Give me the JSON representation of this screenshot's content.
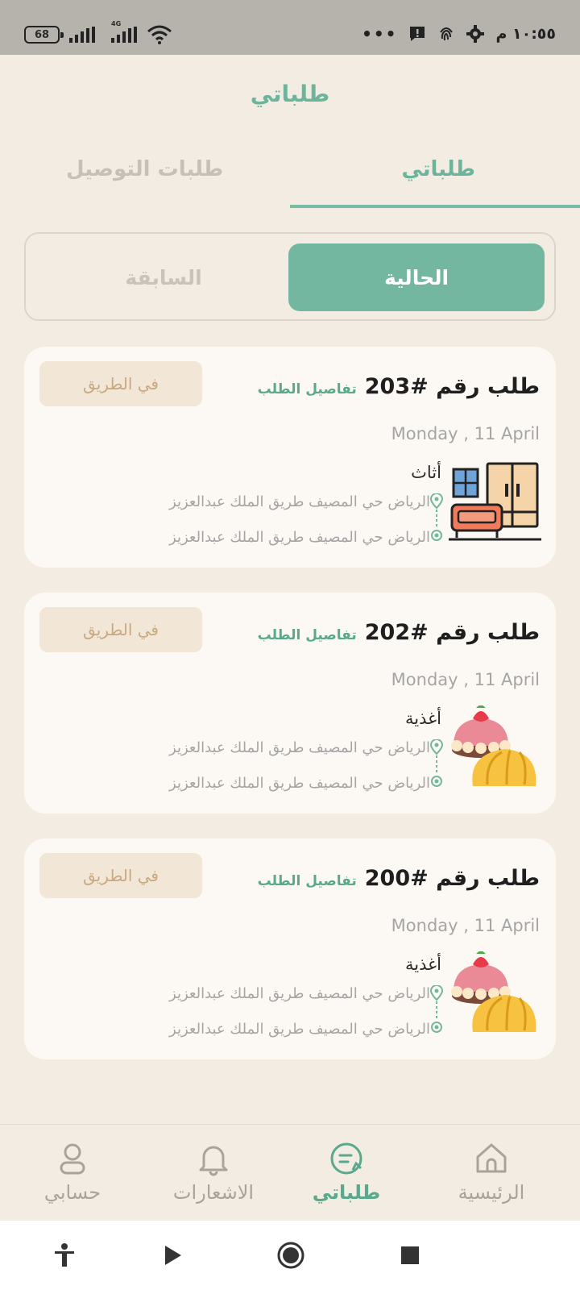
{
  "status_bar": {
    "battery": "68",
    "network": "4G",
    "time": "١٠:٥٥ م",
    "more": "•••"
  },
  "header": {
    "title": "طلباتي"
  },
  "tabs": {
    "mine": "طلباتي",
    "delivery": "طلبات التوصيل"
  },
  "segment": {
    "current": "الحالية",
    "previous": "السابقة"
  },
  "orders": [
    {
      "number": "طلب رقم #203",
      "details": "تفاصيل الطلب",
      "status": "في الطريق",
      "date": "Monday , 11 April",
      "category": "أثاث",
      "pickup": "الرياض  حي المصيف  طريق الملك عبدالعزيز",
      "dropoff": "الرياض  حي المصيف  طريق الملك عبدالعزيز",
      "icon": "furniture-icon"
    },
    {
      "number": "طلب رقم #202",
      "details": "تفاصيل الطلب",
      "status": "في الطريق",
      "date": "Monday , 11 April",
      "category": "أغذية",
      "pickup": "الرياض  حي المصيف  طريق الملك عبدالعزيز",
      "dropoff": "الرياض  حي المصيف  طريق الملك عبدالعزيز",
      "icon": "food-icon"
    },
    {
      "number": "طلب رقم #200",
      "details": "تفاصيل الطلب",
      "status": "في الطريق",
      "date": "Monday , 11 April",
      "category": "أغذية",
      "pickup": "الرياض  حي المصيف  طريق الملك عبدالعزيز",
      "dropoff": "الرياض  حي المصيف  طريق الملك عبدالعزيز",
      "icon": "food-icon"
    }
  ],
  "bottom_nav": {
    "home": "الرئيسية",
    "orders": "طلباتي",
    "notifications": "الاشعارات",
    "account": "حسابي"
  },
  "colors": {
    "accent": "#74b7a0",
    "background": "#f3ece2",
    "card": "#fcf9f4",
    "badge": "#f2e6d6"
  }
}
